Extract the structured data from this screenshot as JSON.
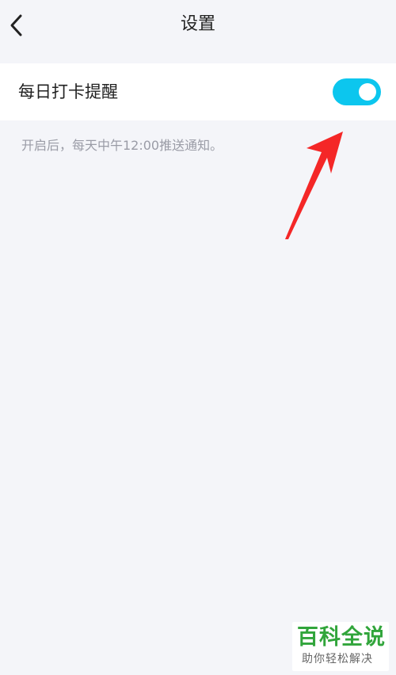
{
  "header": {
    "back_icon": "chevron-left-icon",
    "title": "设置"
  },
  "settings": {
    "daily_checkin_reminder": {
      "label": "每日打卡提醒",
      "enabled": true
    }
  },
  "hint": "开启后，每天中午12:00推送通知。",
  "colors": {
    "background": "#f4f5f9",
    "toggle_on": "#0cc6ee",
    "annotation_arrow": "#f42727",
    "watermark_green": "#31a53b"
  },
  "watermark": {
    "main": "百科全说",
    "sub": "助你轻松解决"
  }
}
